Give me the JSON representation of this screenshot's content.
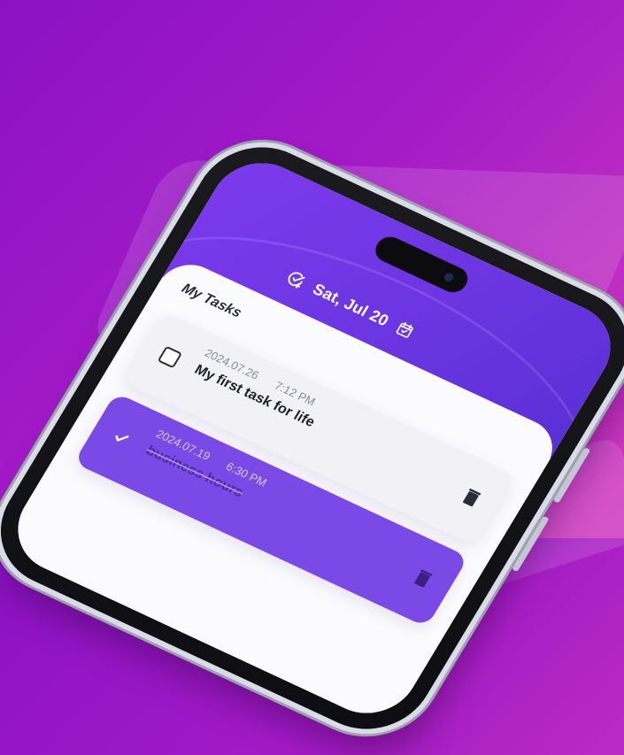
{
  "app": {
    "header": {
      "date": "Sat, Jul 20",
      "icons": {
        "add_task": "add-task-icon",
        "calendar": "calendar-check-icon"
      }
    },
    "section_title": "My Tasks",
    "tasks": [
      {
        "date": "2024.07.26",
        "time": "7:12 PM",
        "title": "My first task for life",
        "completed": false
      },
      {
        "date": "2024.07.19",
        "time": "6:30 PM",
        "title": "business hours",
        "completed": true
      }
    ],
    "colors": {
      "background_start": "#8b12c4",
      "background_end": "#d23cc0",
      "primary": "#7c3aed",
      "completed_card": "#7b4ae6"
    }
  }
}
